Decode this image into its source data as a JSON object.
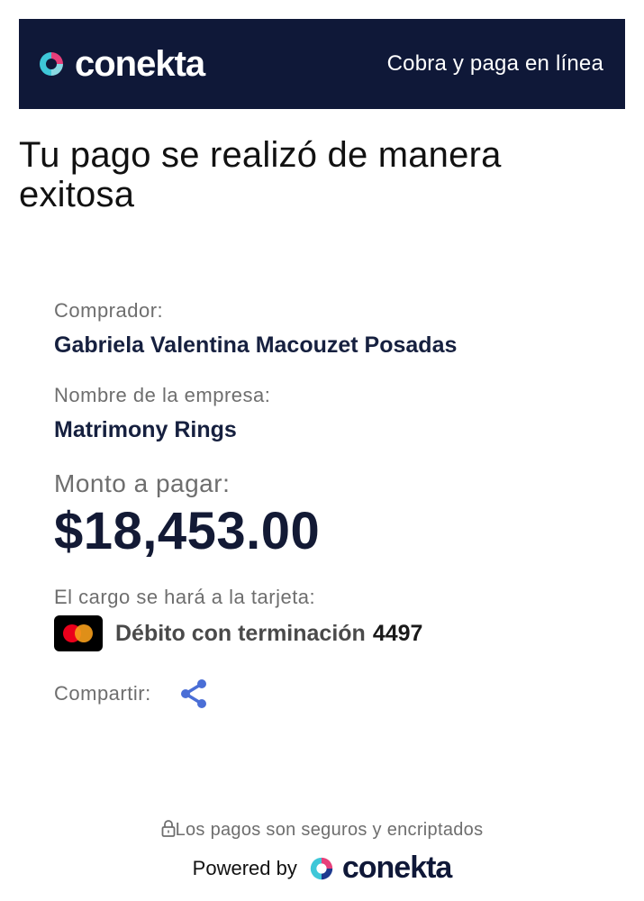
{
  "header": {
    "brand_name": "conekta",
    "tagline": "Cobra y paga en línea",
    "brand_colors": {
      "background": "#0f1838",
      "mark_teal": "#3ec7d8",
      "mark_pink": "#e63f7a"
    }
  },
  "title": "Tu pago se realizó de manera exitosa",
  "buyer": {
    "label": "Comprador:",
    "value": "Gabriela Valentina Macouzet Posadas"
  },
  "company": {
    "label": "Nombre de la empresa:",
    "value": "Matrimony Rings"
  },
  "amount": {
    "label": "Monto a pagar:",
    "value": "$18,453.00"
  },
  "card": {
    "label": "El cargo se hará a la tarjeta:",
    "brand_icon": "mastercard-icon",
    "description": "Débito con terminación",
    "last_digits": "4497"
  },
  "share": {
    "label": "Compartir:",
    "icon": "share-icon",
    "color": "#4a6ed6"
  },
  "footer": {
    "secure_text": "Los pagos son seguros y encriptados",
    "powered_text": "Powered by",
    "powered_brand": "conekta"
  }
}
